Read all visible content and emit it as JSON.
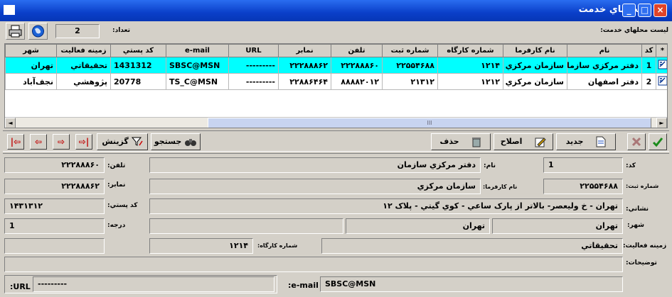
{
  "window": {
    "title": "محلهاي خدمت",
    "minimize": "_",
    "maximize": "□",
    "close": "×"
  },
  "toolbar": {
    "list_label": "ليست محلهاي خدمت:",
    "count_label": "تعداد:",
    "count_value": "2"
  },
  "grid": {
    "columns": [
      "*",
      "کد",
      "نام",
      "نام کارفرما",
      "شماره کارگاه",
      "شماره ثبت",
      "تلفن",
      "نمابر",
      "URL",
      "e-mail",
      "کد پستي",
      "زمينه فعاليت",
      "شهر"
    ],
    "rows": [
      {
        "code": "1",
        "name": "دفتر مرکزي سازمان",
        "employer": "سازمان مرکزي",
        "workshop": "۱۲۱۴",
        "reg": "۲۲۵۵۴۶۸۸",
        "phone": "۲۲۲۸۸۸۶۰",
        "fax": "۲۲۲۸۸۸۶۲",
        "url": "---------",
        "email": "SBSC@MSN",
        "postal": "1431312",
        "activity": "تحقيقاتي",
        "city": "تهران"
      },
      {
        "code": "2",
        "name": "دفتر اصفهان",
        "employer": "سازمان مرکزي",
        "workshop": "۱۲۱۲",
        "reg": "۲۱۳۱۲",
        "phone": "۸۸۸۸۲۰۱۲",
        "fax": "۲۲۸۸۶۴۶۴",
        "url": "---------",
        "email": "TS_C@MSN",
        "postal": "20778",
        "activity": "پژوهشي",
        "city": "نجف‌آباد"
      }
    ],
    "scroll_grip": "III"
  },
  "actions": {
    "new": "جديد",
    "edit": "اصلاح",
    "delete": "حذف",
    "search": "جستجو",
    "filter": "گزينش"
  },
  "nav": {
    "first": "|⇦",
    "prev": "⇦",
    "next": "⇨",
    "last": "⇨|"
  },
  "detail": {
    "code_label": "کد:",
    "code_value": "1",
    "name_label": "نام:",
    "name_value": "دفتر مرکزي سازمان",
    "phone_label": "تلفن:",
    "phone_value": "۲۲۲۸۸۸۶۰",
    "reg_label": "شماره ثبت:",
    "reg_value": "۲۲۵۵۴۶۸۸",
    "employer_label": "نام کارفرما:",
    "employer_value": "سازمان مرکزي",
    "fax_label": "نمابر:",
    "fax_value": "۲۲۲۸۸۸۶۲",
    "address_label": "نشاني:",
    "address_value": "تهران - خ وليعصر- بالاتر از پارک ساعي - کوي گيتي - پلاک ۱۲",
    "postal_label": "کد پستي:",
    "postal_value": "۱۴۳۱۳۱۲",
    "city_label": "شهر:",
    "city_value": "تهران",
    "province_value": "تهران",
    "degree_label": "درجه:",
    "degree_value": "1",
    "activity_label": "زمينه فعاليت:",
    "activity_value": "تحقيقاتي",
    "workshop_label": "شماره کارگاه:",
    "workshop_value": "۱۲۱۴",
    "notes_label": "توضيحات:",
    "notes_value": "",
    "url_label": "URL:",
    "url_value": "---------",
    "email_label": "e-mail:",
    "email_value": "SBSC@MSN"
  },
  "icons": {
    "printer": "printer-icon",
    "globe": "globe-icon",
    "confirm": "check-icon",
    "cancel": "cancel-icon"
  },
  "colors": {
    "title_bar": "#0a3fc9",
    "selected_row": "#00ffff",
    "face": "#d4d0c8"
  }
}
